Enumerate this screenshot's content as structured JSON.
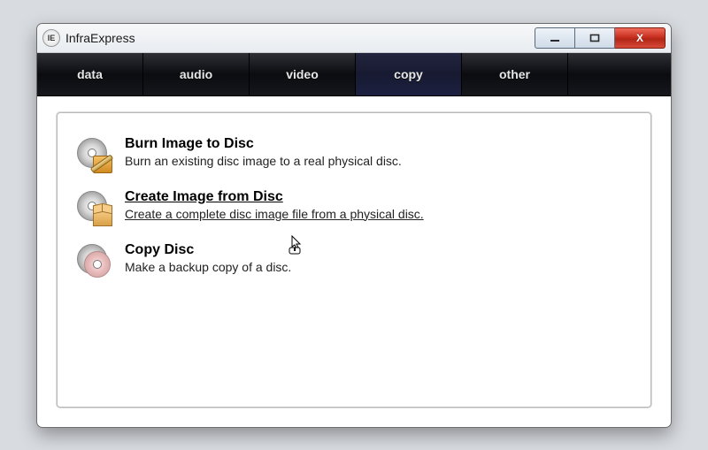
{
  "window": {
    "title": "InfraExpress",
    "app_icon_label": "IE"
  },
  "controls": {
    "minimize": "minimize",
    "maximize": "maximize",
    "close": "X"
  },
  "tabs": {
    "items": [
      {
        "label": "data"
      },
      {
        "label": "audio"
      },
      {
        "label": "video"
      },
      {
        "label": "copy"
      },
      {
        "label": "other"
      }
    ],
    "active_index": 3
  },
  "options": [
    {
      "icon": "disc-burn-icon",
      "title": "Burn Image to Disc",
      "desc": "Burn an existing disc image to a real physical disc."
    },
    {
      "icon": "disc-create-icon",
      "title": "Create Image from Disc",
      "desc": "Create a complete disc image file from a physical disc."
    },
    {
      "icon": "disc-copy-icon",
      "title": "Copy Disc",
      "desc": "Make a backup copy of a disc."
    }
  ],
  "hover_index": 1
}
